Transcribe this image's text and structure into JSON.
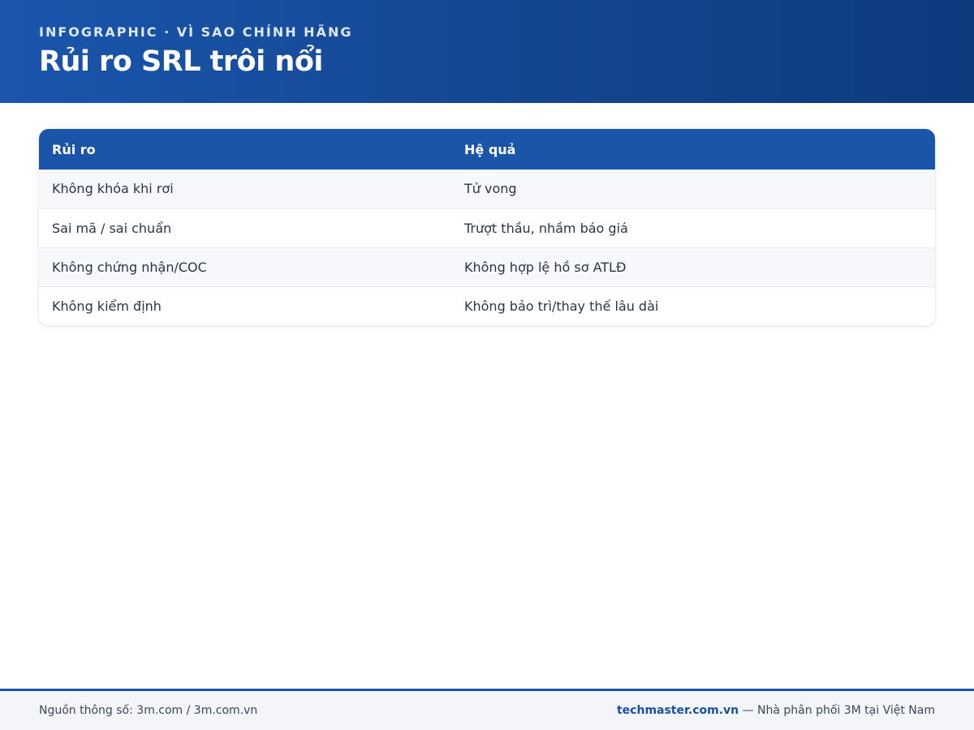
{
  "header": {
    "kicker": "INFOGRAPHIC · VÌ SAO CHÍNH HÃNG",
    "title": "Rủi ro SRL trôi nổi"
  },
  "table": {
    "headers": [
      "Rủi ro",
      "Hệ quả"
    ],
    "rows": [
      [
        "Không khóa khi rơi",
        "Tử vong"
      ],
      [
        "Sai mã / sai chuẩn",
        "Trượt thầu, nhầm báo giá"
      ],
      [
        "Không chứng nhận/COC",
        "Không hợp lệ hồ sơ ATLĐ"
      ],
      [
        "Không kiểm định",
        "Không bảo trì/thay thế lâu dài"
      ]
    ]
  },
  "footer": {
    "source": "Nguồn thông số: 3m.com / 3m.com.vn",
    "brand": "techmaster.com.vn",
    "tagline": " — Nhà phân phối 3M tại Việt Nam"
  },
  "colors": {
    "header_gradient_start": "#1a56ad",
    "header_gradient_end": "#0e3a7e",
    "table_header": "#1a55aa",
    "brand_text": "#1a4f9f",
    "footer_bg": "#f3f5f9"
  }
}
